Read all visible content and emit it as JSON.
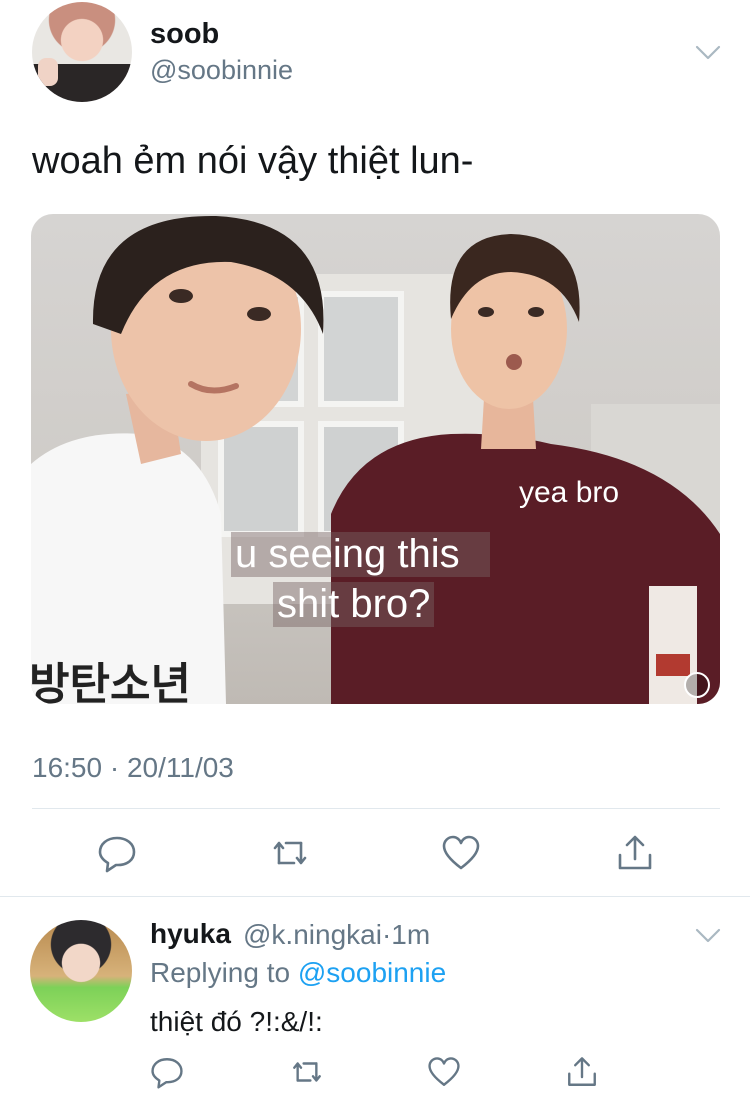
{
  "tweet": {
    "display_name": "soob",
    "handle": "@soobinnie",
    "text": "woah ẻm nói vậy thiệt lun-",
    "media": {
      "captions": [
        "yea bro",
        "u seeing this",
        "shit bro?"
      ]
    },
    "timestamp": "16:50 · 20/11/03",
    "actions": [
      "reply-icon",
      "retweet-icon",
      "like-icon",
      "share-icon"
    ]
  },
  "reply": {
    "display_name": "hyuka",
    "handle": "@k.ningkai",
    "separator": "·",
    "age": "1m",
    "replying_prefix": "Replying to ",
    "replying_to": "@soobinnie",
    "text": "thiệt đó ?!:&/!:",
    "actions": [
      "reply-icon",
      "retweet-icon",
      "like-icon",
      "share-icon"
    ]
  },
  "colors": {
    "text": "#14171a",
    "secondary": "#657786",
    "link": "#1da1f2",
    "divider": "#e1e8ed"
  }
}
